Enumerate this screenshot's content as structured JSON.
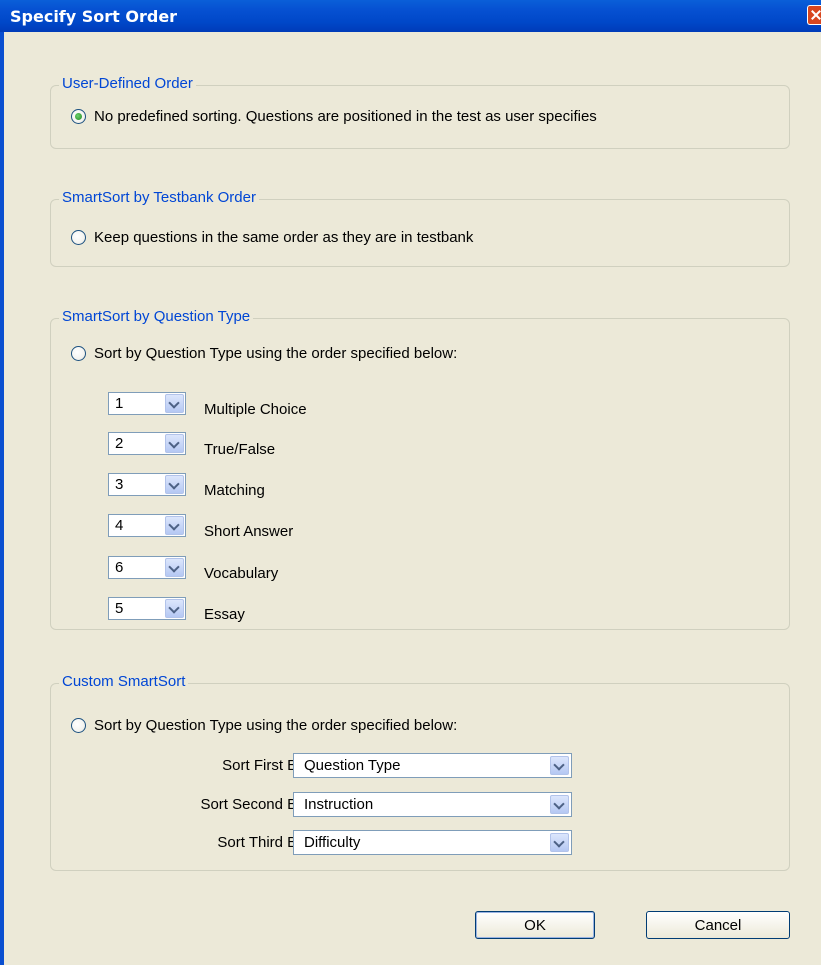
{
  "window": {
    "title": "Specify Sort Order"
  },
  "user_defined": {
    "legend": "User-Defined Order",
    "option": "No predefined sorting. Questions are positioned in the test as user specifies",
    "selected": true
  },
  "testbank_order": {
    "legend": "SmartSort by Testbank Order",
    "option": "Keep questions in the same order as they are in testbank",
    "selected": false
  },
  "question_type": {
    "legend": "SmartSort by Question Type",
    "option": "Sort by Question Type using the order specified below:",
    "selected": false,
    "items": [
      {
        "order": "1",
        "label": "Multiple Choice"
      },
      {
        "order": "2",
        "label": "True/False"
      },
      {
        "order": "3",
        "label": "Matching"
      },
      {
        "order": "4",
        "label": "Short Answer"
      },
      {
        "order": "6",
        "label": "Vocabulary"
      },
      {
        "order": "5",
        "label": "Essay"
      }
    ]
  },
  "custom": {
    "legend": "Custom SmartSort",
    "option": "Sort by Question Type using the order specified below:",
    "selected": false,
    "first_label": "Sort First By :",
    "first_value": "Question Type",
    "second_label": "Sort Second By :",
    "second_value": "Instruction",
    "third_label": "Sort Third By :",
    "third_value": "Difficulty"
  },
  "buttons": {
    "ok": "OK",
    "cancel": "Cancel"
  },
  "colors": {
    "titlebar": "#0050d0",
    "legend": "#0046d5",
    "dialog_bg": "#ece9d8"
  },
  "icons": {
    "close": "close-icon",
    "dropdown": "chevron-down-icon"
  }
}
